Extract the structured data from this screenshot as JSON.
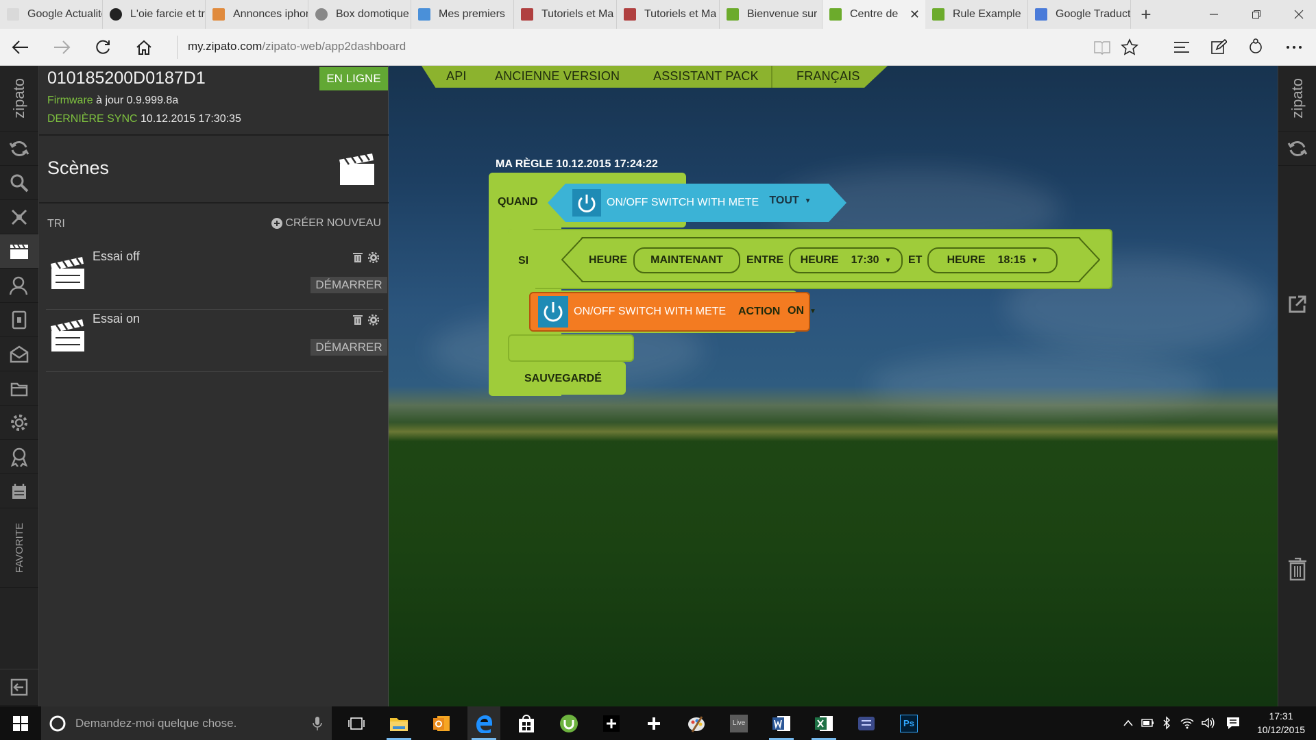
{
  "browser": {
    "tabs": [
      {
        "label": "Google Actualités",
        "color": "#d9d9d9"
      },
      {
        "label": "L'oie farcie et trucs",
        "color": "#222222"
      },
      {
        "label": "Annonces iphone",
        "color": "#e08a3c"
      },
      {
        "label": "Box domotique",
        "color": "#888888"
      },
      {
        "label": "Mes premiers",
        "color": "#4a90d9"
      },
      {
        "label": "Tutoriels et Ma",
        "color": "#b04040"
      },
      {
        "label": "Tutoriels et Ma",
        "color": "#b04040"
      },
      {
        "label": "Bienvenue sur",
        "color": "#6cab2c"
      },
      {
        "label": "Centre de",
        "color": "#6cab2c",
        "active": true
      },
      {
        "label": "Rule Example",
        "color": "#6cab2c"
      },
      {
        "label": "Google Traduction",
        "color": "#4a7bd9"
      }
    ],
    "url": {
      "host": "my.zipato.com",
      "path": "/zipato-web/app2dashboard"
    }
  },
  "sidebar": {
    "brand": "zipato",
    "favorite_label": "FAVORITE",
    "items": [
      {
        "icon": "sync-icon"
      },
      {
        "icon": "search-icon"
      },
      {
        "icon": "network-icon"
      },
      {
        "icon": "scene-clapper-icon",
        "active": true
      },
      {
        "icon": "users-icon"
      },
      {
        "icon": "device-icon"
      },
      {
        "icon": "inbox-icon"
      },
      {
        "icon": "folder-icon"
      },
      {
        "icon": "settings-icon"
      },
      {
        "icon": "badge-icon"
      },
      {
        "icon": "calendar-icon"
      }
    ]
  },
  "device": {
    "id": "010185200D0187D1",
    "status": "EN LIGNE",
    "firmware_label": "Firmware",
    "firmware_value": "à jour 0.9.999.8a",
    "sync_label": "DERNIÈRE SYNC",
    "sync_value": "10.12.2015 17:30:35"
  },
  "scenes": {
    "title": "Scènes",
    "sort_label": "TRI",
    "create_label": "CRÉER NOUVEAU",
    "items": [
      {
        "name": "Essai off",
        "start_label": "DÉMARRER"
      },
      {
        "name": "Essai on",
        "start_label": "DÉMARRER"
      }
    ]
  },
  "topmenu": [
    "API",
    "ANCIENNE VERSION",
    "ASSISTANT PACK",
    "FRANÇAIS"
  ],
  "rule": {
    "title": "MA RÈGLE 10.12.2015 17:24:22",
    "when_label": "QUAND",
    "when_device": "ON/OFF SWITCH WITH METE",
    "when_mode": "TOUT",
    "if_label": "SI",
    "hour_label": "HEURE",
    "now_label": "MAINTENANT",
    "between_label": "ENTRE",
    "hour_from_label": "HEURE",
    "hour_from": "17:30",
    "and_label": "ET",
    "hour_to_label": "HEURE",
    "hour_to": "18:15",
    "action_device": "ON/OFF SWITCH WITH METE",
    "action_label": "ACTION",
    "action_value": "ON",
    "saved_label": "SAUVEGARDÉ",
    "colors": {
      "green": "#9fcc3a",
      "blue": "#3bb3d6",
      "orange": "#f37b21"
    }
  },
  "rightbar": {
    "brand": "zipato"
  },
  "taskbar": {
    "search_placeholder": "Demandez-moi quelque chose.",
    "clock_time": "17:31",
    "clock_date": "10/12/2015",
    "apps": [
      {
        "icon": "task-view-icon"
      },
      {
        "icon": "file-explorer-icon"
      },
      {
        "icon": "outlook-icon"
      },
      {
        "icon": "edge-icon"
      },
      {
        "icon": "store-icon"
      },
      {
        "icon": "utorrent-icon"
      },
      {
        "icon": "plus-app-icon"
      },
      {
        "icon": "plus-app-icon"
      },
      {
        "icon": "paint-icon"
      },
      {
        "icon": "live-icon",
        "label": "Live"
      },
      {
        "icon": "word-icon"
      },
      {
        "icon": "excel-icon"
      },
      {
        "icon": "tool-icon"
      },
      {
        "icon": "photoshop-icon",
        "label": "Ps"
      }
    ]
  }
}
